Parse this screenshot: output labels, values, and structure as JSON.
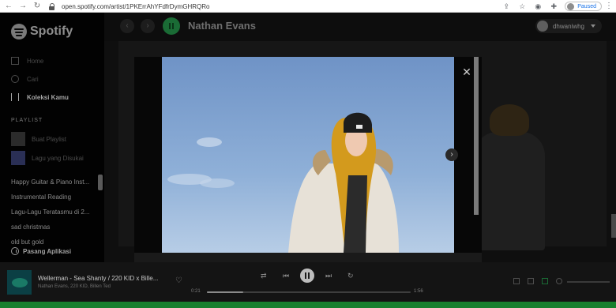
{
  "browser": {
    "url": "open.spotify.com/artist/1PKErrAhYFdfrDymGHRQRo",
    "profile_status": "Paused",
    "icons": [
      "back-arrow-icon",
      "forward-arrow-icon",
      "reload-icon",
      "lock-icon",
      "share-icon",
      "star-icon",
      "chrome-extension-icon",
      "puzzle-icon",
      "menu-dots-icon"
    ]
  },
  "sidebar": {
    "brand": "Spotify",
    "nav": [
      {
        "label": "Home",
        "icon": "home-icon"
      },
      {
        "label": "Cari",
        "icon": "search-icon"
      },
      {
        "label": "Koleksi Kamu",
        "icon": "library-icon"
      }
    ],
    "playlist_header": "PLAYLIST",
    "actions": [
      {
        "label": "Buat Playlist",
        "icon": "plus-icon"
      },
      {
        "label": "Lagu yang Disukai",
        "icon": "heart-icon"
      }
    ],
    "playlists": [
      "Happy Guitar & Piano Inst...",
      "Instrumental Reading",
      "Lagu-Lagu Teratasmu di 2...",
      "sad christmas",
      "old but gold"
    ],
    "install_label": "Pasang Aplikasi"
  },
  "topbar": {
    "artist_name": "Nathan Evans",
    "username": "dhwaniwhg"
  },
  "modal": {
    "close_icon": "close-icon",
    "next_icon": "chevron-right-icon"
  },
  "player": {
    "track_title": "Wellerman - Sea Shanty / 220 KID x Bille...",
    "track_artists": "Nathan Evans, 220 KID, Billen Ted",
    "elapsed": "0:21",
    "duration": "1:56",
    "progress": 0.18
  },
  "colors": {
    "accent": "#1db954",
    "modal_bg": "#070707",
    "scarf": "#d39a1d"
  }
}
